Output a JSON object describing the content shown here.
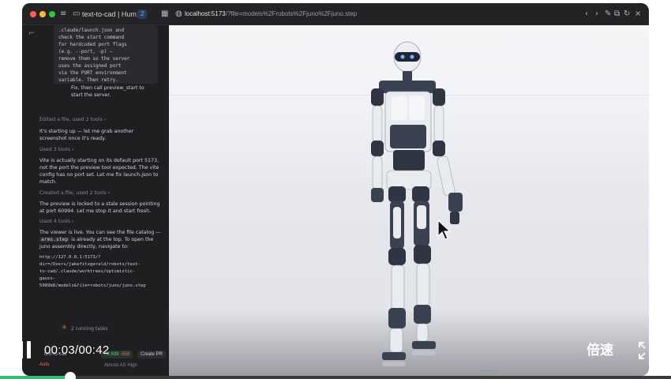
{
  "window": {
    "tab_title": "text-to-cad | Hum...",
    "tab_badge": "2",
    "url_host": "localhost:5173",
    "url_path": "/?file=models%2Frobots%2Fjuno%2Fjuno.step"
  },
  "chat": {
    "code_lines": [
      ".claude/launch.json and",
      "check the start command",
      "for hardcoded port flags",
      "(e.g. --port, -p) —",
      "remove them so the server",
      "uses the assigned port",
      "via the PORT environment",
      "variable. Then retry."
    ],
    "code_tail": [
      "Fix, then call preview_start to",
      "start the server."
    ],
    "edited_meta": "Edited a file, used 2 tools ›",
    "msg1": [
      "It's starting up — let me grab another",
      "screenshot once it's ready."
    ],
    "used3_meta": "Used 3 tools ›",
    "msg2": [
      "Vite is actually starting on its default port 5173,",
      "not the port the preview tool expected. The vite",
      "config has no port set. Let me fix launch.json to",
      "match."
    ],
    "created_meta": "Created a file, used 2 tools ›",
    "msg3": [
      "The preview is locked to a stale session pointing",
      "at port 60994. Let me stop it and start fresh."
    ],
    "used4_meta": "Used 4 tools ›",
    "msg4_a": "The viewer is live. You can see the file catalog —",
    "msg4_code": "arms.step",
    "msg4_b": " is already at the top. To open the",
    "msg4_c": "juno assembly directly, navigate to:",
    "link_lines": [
      "http://127.0.0.1:5173/?",
      "dir=/Users/jakefitzgerald/robots/text-",
      "to-cad/.claude/worktrees/optimistic-",
      "gauss-",
      "5989b8/models&file=robots/juno/juno.step"
    ],
    "running": "2 running tasks"
  },
  "composer": {
    "repo": "text-to-cad",
    "diff_add": "+2,939",
    "diff_del": "-558",
    "create_pr": "Create PR",
    "mode": "Auto",
    "model_info": "Almost AS  High"
  },
  "video": {
    "time": "00:03/00:42",
    "speed_label": "倍速",
    "progress": 0.105
  },
  "colors": {
    "accent": "#e2784b",
    "progress": "#2fbf71",
    "robot_dark": "#3a4150",
    "robot_light": "#e9ebef"
  }
}
